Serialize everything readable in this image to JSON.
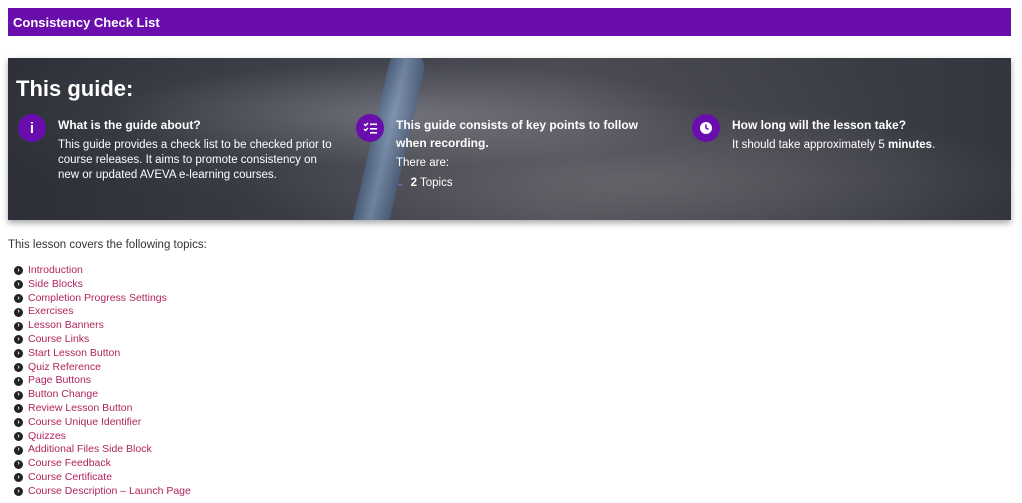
{
  "header": {
    "title": "Consistency Check List"
  },
  "banner": {
    "heading": "This guide:",
    "about": {
      "icon": "info-icon",
      "heading": "What is the guide about?",
      "body": "This guide provides a check list to be checked prior to course releases. It aims to promote consistency on new or updated AVEVA e-learning courses."
    },
    "key_points": {
      "icon": "checklist-icon",
      "heading": "This guide consists of key points to follow when recording.",
      "body": "There are:",
      "topics_count": "2",
      "topics_label": "Topics"
    },
    "duration": {
      "icon": "clock-icon",
      "heading": "How long will the lesson take?",
      "body_prefix": "It should take approximately 5 ",
      "body_bold": "minutes",
      "body_suffix": "."
    }
  },
  "lesson": {
    "intro": "This lesson covers the following topics:",
    "topics": [
      "Introduction",
      "Side Blocks",
      "Completion Progress Settings",
      "Exercises",
      "Lesson Banners",
      "Course Links",
      "Start Lesson Button",
      "Quiz Reference",
      "Page Buttons",
      "Button Change",
      "Review Lesson Button",
      "Course Unique Identifier",
      "Quizzes",
      "Additional Files Side Block",
      "Course Feedback",
      "Course Certificate",
      "Course Description – Launch Page"
    ]
  },
  "colors": {
    "accent": "#6a0dad",
    "link": "#b0245c"
  }
}
